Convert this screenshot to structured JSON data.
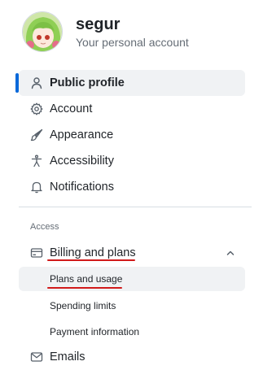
{
  "account": {
    "username": "segur",
    "subtitle": "Your personal account"
  },
  "nav": {
    "items": [
      {
        "label": "Public profile",
        "icon": "person-icon",
        "active": true
      },
      {
        "label": "Account",
        "icon": "gear-icon"
      },
      {
        "label": "Appearance",
        "icon": "paintbrush-icon"
      },
      {
        "label": "Accessibility",
        "icon": "accessibility-icon"
      },
      {
        "label": "Notifications",
        "icon": "bell-icon"
      }
    ]
  },
  "access": {
    "section_label": "Access",
    "billing": {
      "label": "Billing and plans",
      "icon": "credit-card-icon",
      "expanded": true,
      "children": [
        {
          "label": "Plans and usage",
          "current": true
        },
        {
          "label": "Spending limits"
        },
        {
          "label": "Payment information"
        }
      ]
    },
    "emails": {
      "label": "Emails",
      "icon": "mail-icon"
    }
  },
  "colors": {
    "accent": "#0969da",
    "annotation": "#d11a1a",
    "active_bg": "#f0f2f4"
  }
}
